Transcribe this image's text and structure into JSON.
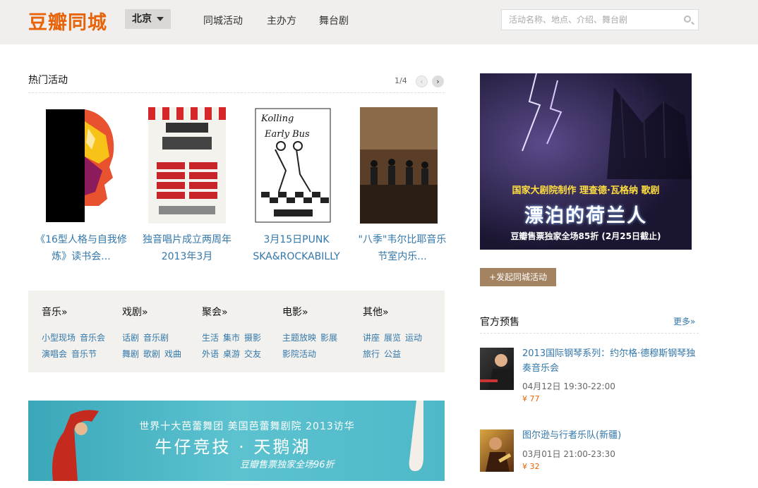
{
  "header": {
    "logo": "豆瓣同城",
    "city": "北京",
    "nav": [
      "同城活动",
      "主办方",
      "舞台剧"
    ],
    "search_placeholder": "活动名称、地点、介绍、舞台剧"
  },
  "hot": {
    "title": "热门活动",
    "pager": "1/4",
    "items": [
      {
        "title": "《16型人格与自我修炼》读书会..."
      },
      {
        "title": "独音唱片成立两周年2013年3月"
      },
      {
        "title": "3月15日PUNK SKA&ROCKABILLY"
      },
      {
        "title": "\"八季\"韦尔比耶音乐节室内乐..."
      }
    ]
  },
  "categories": [
    {
      "name": "音乐»",
      "tags": [
        "小型现场",
        "音乐会",
        "演唱会",
        "音乐节"
      ]
    },
    {
      "name": "戏剧»",
      "tags": [
        "话剧",
        "音乐剧",
        "舞剧",
        "歌剧",
        "戏曲"
      ]
    },
    {
      "name": "聚会»",
      "tags": [
        "生活",
        "集市",
        "摄影",
        "外语",
        "桌游",
        "交友"
      ]
    },
    {
      "name": "电影»",
      "tags": [
        "主题放映",
        "影展",
        "影院活动"
      ]
    },
    {
      "name": "其他»",
      "tags": [
        "讲座",
        "展览",
        "运动",
        "旅行",
        "公益"
      ]
    }
  ],
  "banner": {
    "line1": "世界十大芭蕾舞团 美国芭蕾舞剧院 2013访华",
    "line2": "牛仔竞技 · 天鹅湖",
    "line3": "豆瓣售票独家全场96折"
  },
  "ad": {
    "line1": "国家大剧院制作 理查德·瓦格纳 歌剧",
    "line2": "漂泊的荷兰人",
    "line3": "豆瓣售票独家全场85折 (2月25日截止)"
  },
  "launch_button": "+发起同城活动",
  "official": {
    "title": "官方预售",
    "more": "更多»",
    "events": [
      {
        "title": "2013国际钢琴系列：约尔格·德穆斯钢琴独奏音乐会",
        "time": "04月12日 19:30-22:00",
        "price": "¥ 77"
      },
      {
        "title": "图尔逊与行者乐队(新疆)",
        "time": "03月01日 21:00-23:30",
        "price": "¥ 32"
      }
    ]
  },
  "colors": {
    "accent": "#e8640a",
    "link": "#3377aa",
    "header_bg": "#f0efed",
    "button": "#a38361"
  }
}
